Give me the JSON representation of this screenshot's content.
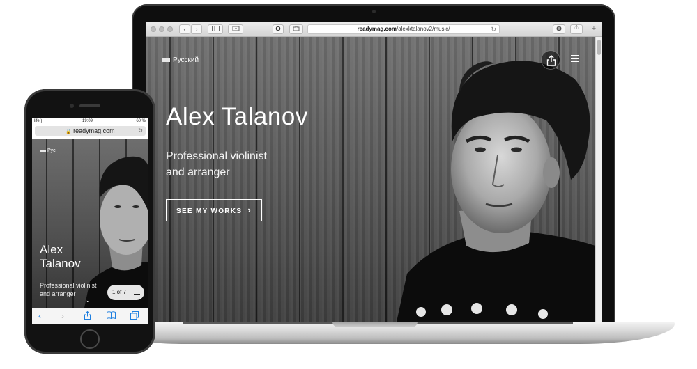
{
  "laptop": {
    "browser": {
      "url_domain": "readymag.com",
      "url_path": "/alexktalanov2/music/"
    },
    "page": {
      "language": "Русский",
      "hero_title": "Alex Talanov",
      "hero_subtitle_line1": "Professional violinist",
      "hero_subtitle_line2": "and arranger",
      "cta_label": "SEE MY WORKS",
      "cta_chevron": "›"
    }
  },
  "phone": {
    "status": {
      "carrier": "life:)",
      "time": "19:09",
      "battery": "60 %"
    },
    "url": "readymag.com",
    "page": {
      "language": "Рус",
      "title": "Alex Talanov",
      "subtitle_line1": "Professional violinist",
      "subtitle_line2": "and arranger",
      "pager": "1 of 7"
    }
  },
  "colors": {
    "accent_blue": "#1e7fe0",
    "laptop_bezel": "#0e0e0e",
    "page_text": "#ffffff"
  },
  "icons": {
    "share": "share-icon",
    "menu": "hamburger-menu-icon",
    "reload": "reload-icon",
    "lock": "lock-icon",
    "back": "back-arrow-icon",
    "forward": "forward-arrow-icon",
    "bookmarks": "bookmarks-icon",
    "tabs": "tabs-icon"
  }
}
